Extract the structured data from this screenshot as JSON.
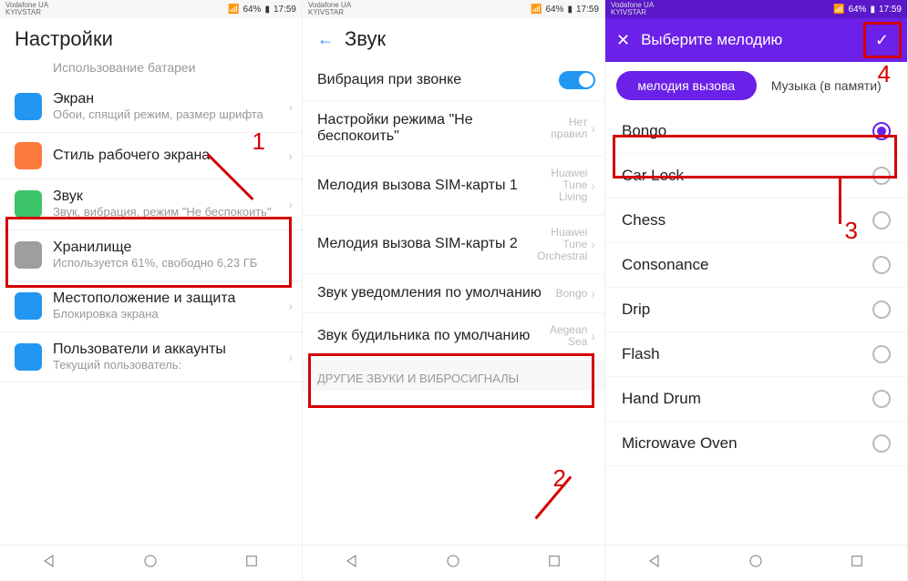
{
  "status": {
    "carrier": "Vodafone UA\nKYIVSTAR",
    "signal": "64%",
    "time": "17:59"
  },
  "annotations": {
    "n1": "1",
    "n2": "2",
    "n3": "3",
    "n4": "4"
  },
  "screen1": {
    "title": "Настройки",
    "partial": "Использование батареи",
    "items": [
      {
        "title": "Экран",
        "sub": "Обои, спящий режим, размер шрифта",
        "color": "#2196f3"
      },
      {
        "title": "Стиль рабочего экрана",
        "sub": "",
        "color": "#ff7a3d"
      },
      {
        "title": "Звук",
        "sub": "Звук, вибрация, режим \"Не беспокоить\"",
        "color": "#3bc46a"
      },
      {
        "title": "Хранилище",
        "sub": "Используется 61%, свободно 6,23 ГБ",
        "color": "#9e9e9e"
      },
      {
        "title": "Местоположение и защита",
        "sub": "Блокировка экрана",
        "color": "#2196f3"
      },
      {
        "title": "Пользователи и аккаунты",
        "sub": "Текущий пользователь:",
        "color": "#2196f3"
      }
    ]
  },
  "screen2": {
    "title": "Звук",
    "rows": [
      {
        "title": "Вибрация при звонке",
        "toggle": true
      },
      {
        "title": "Настройки режима \"Не беспокоить\"",
        "val": "Нет правил"
      },
      {
        "title": "Мелодия вызова SIM-карты 1",
        "val": "Huawei Tune Living"
      },
      {
        "title": "Мелодия вызова SIM-карты 2",
        "val": "Huawei Tune Orchestral"
      },
      {
        "title": "Звук уведомления по умолчанию",
        "val": "Bongo"
      },
      {
        "title": "Звук будильника по умолчанию",
        "val": "Aegean Sea"
      }
    ],
    "sectionHeader": "ДРУГИЕ ЗВУКИ И ВИБРОСИГНАЛЫ"
  },
  "screen3": {
    "title": "Выберите мелодию",
    "tab_active": "мелодия вызова",
    "tab_inactive": "Музыка (в памяти)",
    "ringtones": [
      "Bongo",
      "Car Lock",
      "Chess",
      "Consonance",
      "Drip",
      "Flash",
      "Hand Drum",
      "Microwave Oven"
    ]
  }
}
